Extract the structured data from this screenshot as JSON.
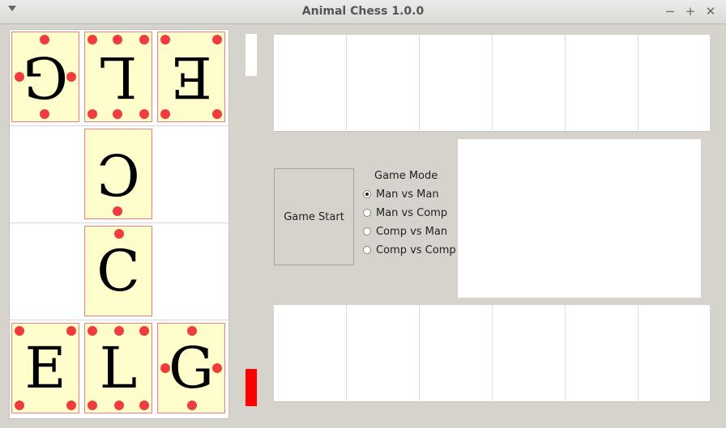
{
  "window": {
    "title": "Animal Chess 1.0.0",
    "min": "−",
    "max": "+",
    "close": "✕"
  },
  "board": {
    "row0": [
      {
        "glyph": "G",
        "flipped": true
      },
      {
        "glyph": "L",
        "flipped": true
      },
      {
        "glyph": "E",
        "flipped": true
      }
    ],
    "row1": [
      null,
      {
        "glyph": "C",
        "flipped": true
      },
      null
    ],
    "row2": [
      null,
      {
        "glyph": "C",
        "flipped": false
      },
      null
    ],
    "row3": [
      {
        "glyph": "E",
        "flipped": false
      },
      {
        "glyph": "L",
        "flipped": false
      },
      {
        "glyph": "G",
        "flipped": false
      }
    ]
  },
  "controls": {
    "start_label": "Game Start",
    "mode_title": "Game Mode",
    "modes": [
      "Man vs Man",
      "Man vs Comp",
      "Comp vs Man",
      "Comp vs Comp"
    ],
    "selected_mode": "Man vs Man"
  },
  "colors": {
    "card_bg": "#fffdcc",
    "dot": "#f03c3c",
    "active_turn": "#ff0000"
  }
}
